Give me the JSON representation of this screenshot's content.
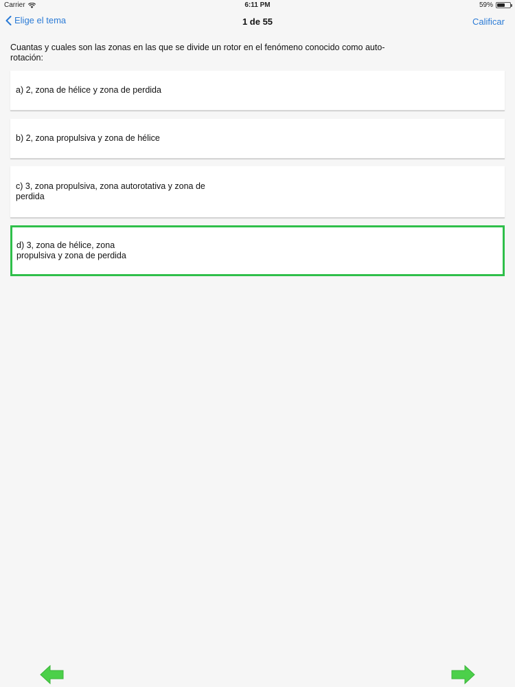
{
  "status_bar": {
    "carrier": "Carrier",
    "time": "6:11 PM",
    "battery": "59%",
    "battery_level": 0.59,
    "wifi_icon": "wifi-icon",
    "battery_icon": "battery-icon"
  },
  "nav": {
    "back_label": "Elige el tema",
    "back_icon": "chevron-left-icon",
    "title": "1 de 55",
    "grade_label": "Calificar"
  },
  "question": {
    "text": "Cuantas y cuales son las zonas en las que se divide un rotor en el fenómeno conocido como auto-rotación:"
  },
  "options": [
    {
      "text": "a) 2, zona de hélice y zona de perdida",
      "selected": false
    },
    {
      "text": "b) 2, zona propulsiva y zona de hélice",
      "selected": false
    },
    {
      "text": "c) 3, zona propulsiva, zona autorotativa y zona de perdida",
      "selected": false
    },
    {
      "text": "d) 3, zona de hélice, zona propulsiva y zona de perdida",
      "selected": true
    }
  ],
  "footer": {
    "prev_icon": "arrow-left-icon",
    "next_icon": "arrow-right-icon"
  },
  "colors": {
    "accent": "#2b7bd6",
    "selected_border": "#2fbf4a",
    "arrow": "#4cd04a",
    "background": "#f6f6f6"
  }
}
